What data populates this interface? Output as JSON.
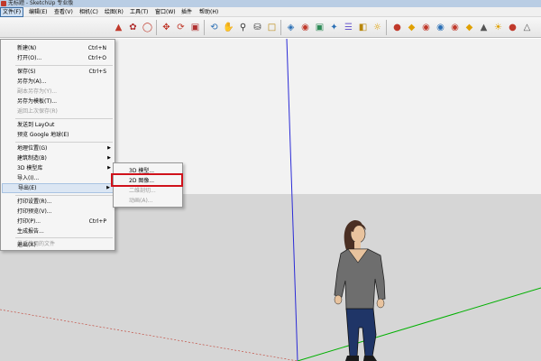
{
  "window": {
    "title": "无标题 - SketchUp 专业版"
  },
  "menubar": {
    "items": [
      {
        "label": "文件(F)"
      },
      {
        "label": "编辑(E)"
      },
      {
        "label": "查看(V)"
      },
      {
        "label": "相机(C)"
      },
      {
        "label": "绘图(R)"
      },
      {
        "label": "工具(T)"
      },
      {
        "label": "窗口(W)"
      },
      {
        "label": "插件"
      },
      {
        "label": "帮助(H)"
      }
    ]
  },
  "toolbar": {
    "tools": [
      "push-pull-icon",
      "follow-me-icon",
      "offset-icon",
      "move-icon",
      "rotate-icon",
      "scale-icon",
      "orbit-icon",
      "pan-icon",
      "zoom-icon",
      "zoom-window-icon",
      "zoom-extents-icon",
      "section-plane-icon",
      "materials-icon",
      "components-icon",
      "styles-icon",
      "layers-icon",
      "scenes-icon",
      "shadows-icon",
      "fog-icon",
      "soften-edges-icon",
      "geo-location-icon",
      "photo-textures-icon",
      "model-info-icon",
      "get-models-icon",
      "share-model-icon",
      "share-component-icon",
      "3d-warehouse-icon",
      "extension-warehouse-icon",
      "ruby-console-icon",
      "sun-icon",
      "sandbox-icon"
    ]
  },
  "file_menu": {
    "items": [
      {
        "label": "新建(N)",
        "shortcut": "Ctrl+N",
        "disabled": false,
        "submenu": false
      },
      {
        "label": "打开(O)...",
        "shortcut": "Ctrl+O",
        "disabled": false,
        "submenu": false
      },
      {
        "label": "保存(S)",
        "shortcut": "Ctrl+S",
        "disabled": false,
        "submenu": false
      },
      {
        "label": "另存为(A)...",
        "shortcut": "",
        "disabled": false,
        "submenu": false
      },
      {
        "label": "副本另存为(Y)...",
        "shortcut": "",
        "disabled": true,
        "submenu": false
      },
      {
        "label": "另存为模板(T)...",
        "shortcut": "",
        "disabled": false,
        "submenu": false
      },
      {
        "label": "返回上次保存(R)",
        "shortcut": "",
        "disabled": true,
        "submenu": false
      },
      {
        "label": "发送到 LayOut",
        "shortcut": "",
        "disabled": false,
        "submenu": false
      },
      {
        "label": "预览 Google 地球(E)",
        "shortcut": "",
        "disabled": false,
        "submenu": false
      },
      {
        "label": "地理位置(G)",
        "shortcut": "",
        "disabled": false,
        "submenu": true
      },
      {
        "label": "建筑制造(B)",
        "shortcut": "",
        "disabled": false,
        "submenu": true
      },
      {
        "label": "3D 模型库",
        "shortcut": "",
        "disabled": false,
        "submenu": true
      },
      {
        "label": "导入(I)...",
        "shortcut": "",
        "disabled": false,
        "submenu": false
      },
      {
        "label": "导出(E)",
        "shortcut": "",
        "disabled": false,
        "submenu": true
      },
      {
        "label": "打印设置(R)...",
        "shortcut": "",
        "disabled": false,
        "submenu": false
      },
      {
        "label": "打印预览(V)...",
        "shortcut": "",
        "disabled": false,
        "submenu": false
      },
      {
        "label": "打印(P)...",
        "shortcut": "Ctrl+P",
        "disabled": false,
        "submenu": false
      },
      {
        "label": "生成报告...",
        "shortcut": "",
        "disabled": false,
        "submenu": false
      },
      {
        "label": "最近使用的文件",
        "shortcut": "",
        "disabled": true,
        "submenu": false
      },
      {
        "label": "退出(X)",
        "shortcut": "",
        "disabled": false,
        "submenu": false
      }
    ]
  },
  "export_submenu": {
    "items": [
      {
        "label": "3D 模型...",
        "disabled": false
      },
      {
        "label": "2D 图像...",
        "disabled": false
      },
      {
        "label": "二维剖切...",
        "disabled": true
      },
      {
        "label": "动画(A)...",
        "disabled": true
      }
    ]
  },
  "colors": {
    "accent": "#3a6ea5",
    "highlight_box": "#d0121b",
    "viewport_background": "#dcdcdc",
    "blue_axis": "#2b2bd6",
    "green_axis": "#00b000",
    "red_axis": "#c0392b"
  }
}
